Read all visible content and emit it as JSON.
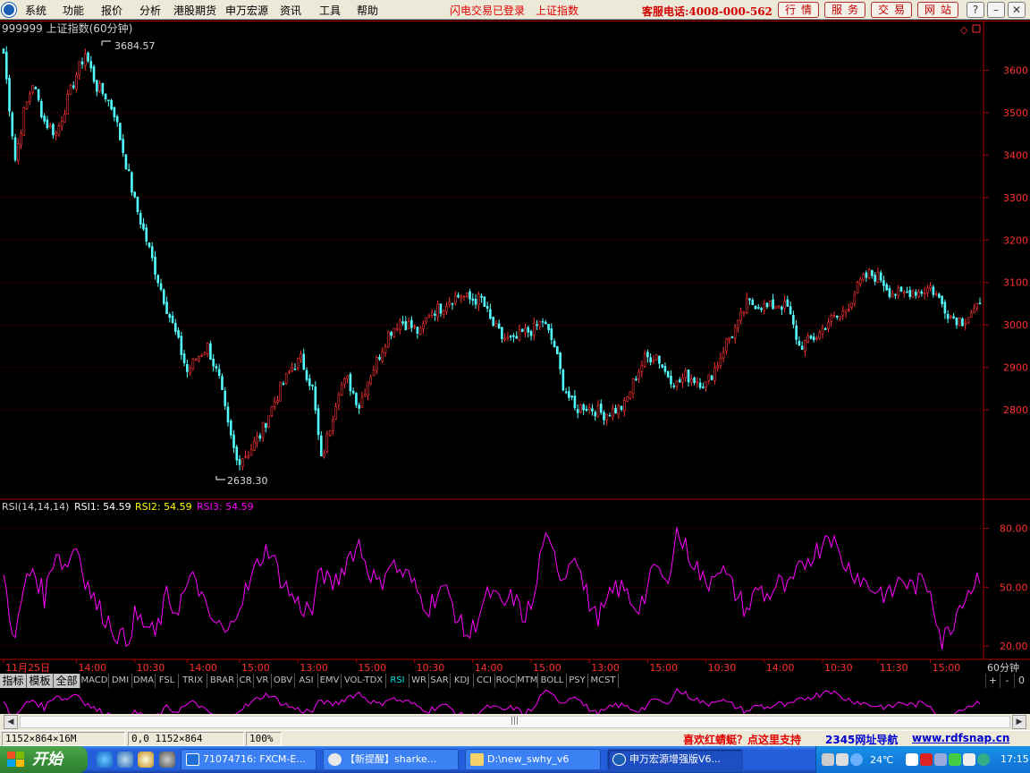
{
  "menu": {
    "items": [
      "系统",
      "功能",
      "报价",
      "分析",
      "港股期货",
      "申万宏源",
      "资讯",
      "工具",
      "帮助"
    ],
    "notice_login": "闪电交易已登录",
    "notice_index": "上证指数",
    "phone": "客服电话:4008-000-562",
    "nav_buttons": [
      "行情",
      "服务",
      "交易",
      "网站"
    ],
    "window_buttons": [
      "?",
      "–",
      "⧉",
      "✕"
    ]
  },
  "chart_data": [
    {
      "type": "candlestick",
      "title": "999999 上证指数(60分钟)",
      "period": "60分钟",
      "ylim": [
        2600,
        3700
      ],
      "yticks": [
        2800,
        2900,
        3000,
        3100,
        3200,
        3300,
        3400,
        3500,
        3600
      ],
      "high_marker": "3684.57",
      "low_marker": "2638.30",
      "up_color": "#ff3232",
      "down_color": "#54ffff",
      "grid": true,
      "close_anchors": [
        [
          0,
          3640
        ],
        [
          4,
          3390
        ],
        [
          7,
          3500
        ],
        [
          10,
          3570
        ],
        [
          14,
          3480
        ],
        [
          18,
          3450
        ],
        [
          21,
          3510
        ],
        [
          25,
          3590
        ],
        [
          28,
          3640
        ],
        [
          32,
          3560
        ],
        [
          35,
          3540
        ],
        [
          38,
          3500
        ],
        [
          42,
          3380
        ],
        [
          45,
          3290
        ],
        [
          49,
          3200
        ],
        [
          52,
          3130
        ],
        [
          56,
          3040
        ],
        [
          59,
          2980
        ],
        [
          63,
          2890
        ],
        [
          66,
          2920
        ],
        [
          70,
          2950
        ],
        [
          74,
          2870
        ],
        [
          77,
          2760
        ],
        [
          80,
          2680
        ],
        [
          84,
          2700
        ],
        [
          88,
          2740
        ],
        [
          91,
          2790
        ],
        [
          95,
          2850
        ],
        [
          99,
          2900
        ],
        [
          102,
          2920
        ],
        [
          106,
          2850
        ],
        [
          109,
          2680
        ],
        [
          112,
          2760
        ],
        [
          115,
          2850
        ],
        [
          118,
          2870
        ],
        [
          122,
          2810
        ],
        [
          125,
          2870
        ],
        [
          129,
          2930
        ],
        [
          132,
          2980
        ],
        [
          136,
          3010
        ],
        [
          139,
          3000
        ],
        [
          143,
          2980
        ],
        [
          146,
          3030
        ],
        [
          150,
          3040
        ],
        [
          153,
          3060
        ],
        [
          157,
          3070
        ],
        [
          160,
          3060
        ],
        [
          164,
          3060
        ],
        [
          167,
          3010
        ],
        [
          171,
          2970
        ],
        [
          175,
          2960
        ],
        [
          178,
          2980
        ],
        [
          182,
          2990
        ],
        [
          185,
          3010
        ],
        [
          189,
          2950
        ],
        [
          192,
          2860
        ],
        [
          196,
          2800
        ],
        [
          199,
          2810
        ],
        [
          203,
          2800
        ],
        [
          206,
          2790
        ],
        [
          210,
          2800
        ],
        [
          213,
          2810
        ],
        [
          217,
          2880
        ],
        [
          220,
          2920
        ],
        [
          224,
          2930
        ],
        [
          227,
          2890
        ],
        [
          231,
          2860
        ],
        [
          234,
          2880
        ],
        [
          238,
          2870
        ],
        [
          241,
          2860
        ],
        [
          245,
          2910
        ],
        [
          248,
          2960
        ],
        [
          252,
          3000
        ],
        [
          255,
          3050
        ],
        [
          259,
          3050
        ],
        [
          262,
          3040
        ],
        [
          266,
          3050
        ],
        [
          269,
          3040
        ],
        [
          273,
          2950
        ],
        [
          276,
          2960
        ],
        [
          280,
          2980
        ],
        [
          283,
          3010
        ],
        [
          287,
          3020
        ],
        [
          290,
          3050
        ],
        [
          294,
          3100
        ],
        [
          297,
          3120
        ],
        [
          301,
          3110
        ],
        [
          304,
          3080
        ],
        [
          308,
          3070
        ],
        [
          311,
          3080
        ],
        [
          315,
          3080
        ],
        [
          318,
          3090
        ],
        [
          322,
          3050
        ],
        [
          325,
          3020
        ],
        [
          329,
          3010
        ],
        [
          332,
          3030
        ],
        [
          335,
          3040
        ]
      ],
      "rsi": {
        "label": "RSI(14,14,14)",
        "rsi1_label": "RSI1: 54.59",
        "rsi2_label": "RSI2: 54.59",
        "rsi3_label": "RSI3: 54.59",
        "line_color": "#ff00ff",
        "ylim": [
          15,
          88
        ],
        "yticks": [
          20.0,
          50.0,
          80.0
        ],
        "anchors": [
          [
            0,
            55
          ],
          [
            4,
            22
          ],
          [
            7,
            50
          ],
          [
            10,
            60
          ],
          [
            14,
            45
          ],
          [
            18,
            70
          ],
          [
            21,
            60
          ],
          [
            25,
            72
          ],
          [
            28,
            55
          ],
          [
            32,
            40
          ],
          [
            35,
            35
          ],
          [
            38,
            28
          ],
          [
            42,
            22
          ],
          [
            45,
            35
          ],
          [
            49,
            30
          ],
          [
            52,
            25
          ],
          [
            56,
            45
          ],
          [
            59,
            38
          ],
          [
            63,
            50
          ],
          [
            66,
            55
          ],
          [
            70,
            35
          ],
          [
            74,
            30
          ],
          [
            77,
            25
          ],
          [
            80,
            40
          ],
          [
            84,
            50
          ],
          [
            88,
            65
          ],
          [
            91,
            70
          ],
          [
            95,
            55
          ],
          [
            99,
            45
          ],
          [
            102,
            40
          ],
          [
            106,
            38
          ],
          [
            109,
            60
          ],
          [
            112,
            50
          ],
          [
            115,
            55
          ],
          [
            118,
            65
          ],
          [
            122,
            72
          ],
          [
            125,
            60
          ],
          [
            129,
            50
          ],
          [
            132,
            63
          ],
          [
            136,
            58
          ],
          [
            139,
            55
          ],
          [
            143,
            45
          ],
          [
            146,
            40
          ],
          [
            150,
            50
          ],
          [
            153,
            45
          ],
          [
            157,
            30
          ],
          [
            160,
            25
          ],
          [
            164,
            40
          ],
          [
            167,
            47
          ],
          [
            171,
            40
          ],
          [
            175,
            45
          ],
          [
            178,
            35
          ],
          [
            182,
            42
          ],
          [
            185,
            75
          ],
          [
            189,
            65
          ],
          [
            192,
            55
          ],
          [
            196,
            70
          ],
          [
            199,
            50
          ],
          [
            203,
            35
          ],
          [
            206,
            38
          ],
          [
            210,
            50
          ],
          [
            213,
            48
          ],
          [
            217,
            40
          ],
          [
            220,
            45
          ],
          [
            224,
            62
          ],
          [
            227,
            50
          ],
          [
            231,
            78
          ],
          [
            234,
            70
          ],
          [
            238,
            60
          ],
          [
            241,
            50
          ],
          [
            245,
            62
          ],
          [
            248,
            55
          ],
          [
            252,
            45
          ],
          [
            255,
            38
          ],
          [
            259,
            50
          ],
          [
            262,
            45
          ],
          [
            266,
            52
          ],
          [
            269,
            48
          ],
          [
            273,
            58
          ],
          [
            276,
            65
          ],
          [
            280,
            70
          ],
          [
            283,
            80
          ],
          [
            287,
            65
          ],
          [
            290,
            60
          ],
          [
            294,
            55
          ],
          [
            297,
            50
          ],
          [
            301,
            48
          ],
          [
            304,
            45
          ],
          [
            308,
            55
          ],
          [
            311,
            50
          ],
          [
            315,
            52
          ],
          [
            318,
            50
          ],
          [
            322,
            22
          ],
          [
            325,
            30
          ],
          [
            329,
            45
          ],
          [
            332,
            50
          ],
          [
            335,
            57
          ]
        ]
      },
      "x_labels": [
        "11月25日",
        "14:00",
        "10:30",
        "14:00",
        "15:00",
        "13:00",
        "15:00",
        "10:30",
        "14:00",
        "15:00",
        "13:00",
        "15:00",
        "10:30",
        "14:00",
        "10:30",
        "11:30",
        "15:00"
      ],
      "x_label_bars": [
        0,
        25,
        45,
        63,
        81,
        101,
        121,
        141,
        161,
        181,
        201,
        221,
        241,
        261,
        281,
        300,
        318
      ],
      "period_tag": "60分钟"
    }
  ],
  "indicator_tabs": [
    "指标",
    "模板",
    "全部",
    "MACD",
    "DMI",
    "DMA",
    "FSL",
    "TRIX",
    "BRAR",
    "CR",
    "VR",
    "OBV",
    "ASI",
    "EMV",
    "VOL-TDX",
    "RSI",
    "WR",
    "SAR",
    "KDJ",
    "CCI",
    "ROC",
    "MTM",
    "BOLL",
    "PSY",
    "MCST"
  ],
  "active_tab": "RSI",
  "tab_controls": [
    "+",
    "-",
    "0"
  ],
  "status": {
    "size": "1152×864×16M",
    "coords": "0,0 1152×864",
    "zoom": "100%",
    "promo": "喜欢红蜻蜓？点这里支持",
    "nav": "2345网址导航",
    "url": "www.rdfsnap.cn"
  },
  "taskbar": {
    "start": "开始",
    "tasks": [
      "71074716: FXCM-E...",
      "【新提醒】sharke...",
      "D:\\new_swhy_v6",
      "申万宏源增强版V6..."
    ],
    "temperature": "24℃",
    "clock": "17:15"
  }
}
